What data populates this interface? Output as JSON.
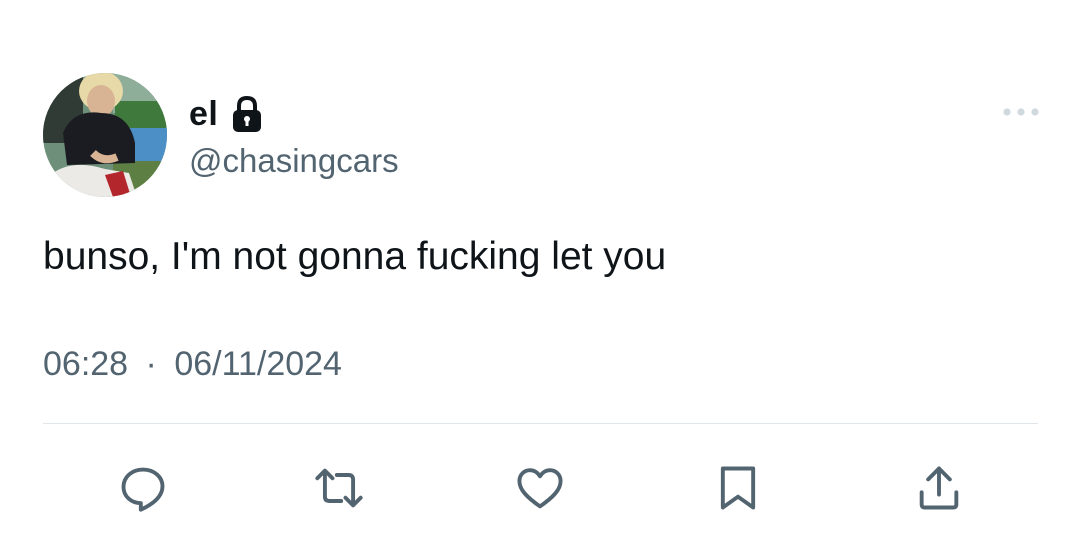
{
  "author": {
    "display_name": "el",
    "handle": "@chasingcars",
    "protected_icon": "lock-icon",
    "avatar_icon": "profile-photo"
  },
  "tweet": {
    "text": "bunso, I'm not gonna fucking let you",
    "time": "06:28",
    "separator": "·",
    "date": "06/11/2024"
  },
  "menu_icon": "more-horizontal-icon",
  "actions": [
    {
      "name": "reply",
      "icon": "reply-icon"
    },
    {
      "name": "retweet",
      "icon": "retweet-icon"
    },
    {
      "name": "like",
      "icon": "heart-icon"
    },
    {
      "name": "bookmark",
      "icon": "bookmark-icon"
    },
    {
      "name": "share",
      "icon": "share-icon"
    }
  ],
  "colors": {
    "text_primary": "#0f1419",
    "text_secondary": "#536471",
    "icon": "#536471",
    "divider": "#e1e6ea"
  }
}
